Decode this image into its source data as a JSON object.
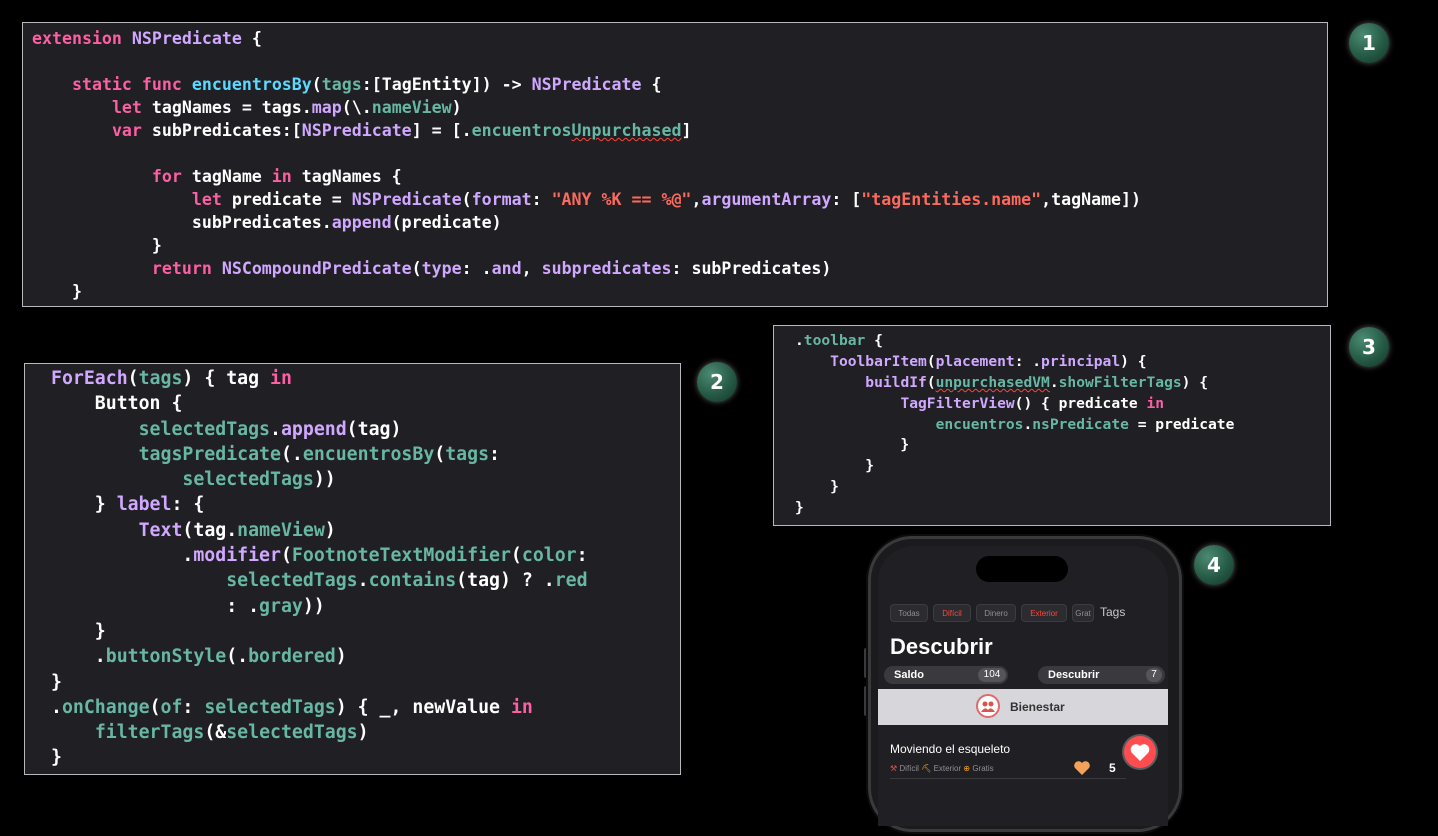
{
  "panel1": {
    "lines": [
      [
        [
          "kw",
          "extension"
        ],
        [
          "p",
          " "
        ],
        [
          "typ",
          "NSPredicate"
        ],
        [
          "p",
          " {"
        ]
      ],
      [],
      [
        [
          "p",
          "    "
        ],
        [
          "kw",
          "static"
        ],
        [
          "p",
          " "
        ],
        [
          "kw",
          "func"
        ],
        [
          "p",
          " "
        ],
        [
          "ident",
          "encuentrosBy"
        ],
        [
          "p",
          "("
        ],
        [
          "fn",
          "tags"
        ],
        [
          "p",
          ":[TagEntity]) -> "
        ],
        [
          "typ",
          "NSPredicate"
        ],
        [
          "p",
          " {"
        ]
      ],
      [
        [
          "p",
          "        "
        ],
        [
          "kw",
          "let"
        ],
        [
          "p",
          " tagNames = tags."
        ],
        [
          "typ",
          "map"
        ],
        [
          "p",
          "(\\."
        ],
        [
          "fn",
          "nameView"
        ],
        [
          "p",
          ")"
        ]
      ],
      [
        [
          "p",
          "        "
        ],
        [
          "kw",
          "var"
        ],
        [
          "p",
          " subPredicates:["
        ],
        [
          "typ",
          "NSPredicate"
        ],
        [
          "p",
          "] = [."
        ],
        [
          "fn",
          "encuentros"
        ],
        [
          "fsq",
          "Unpurchased"
        ],
        [
          "p",
          "]"
        ]
      ],
      [],
      [
        [
          "p",
          "            "
        ],
        [
          "kw",
          "for"
        ],
        [
          "p",
          " tagName "
        ],
        [
          "kw",
          "in"
        ],
        [
          "p",
          " tagNames {"
        ]
      ],
      [
        [
          "p",
          "                "
        ],
        [
          "kw",
          "let"
        ],
        [
          "p",
          " predicate = "
        ],
        [
          "typ",
          "NSPredicate"
        ],
        [
          "p",
          "("
        ],
        [
          "typ",
          "format"
        ],
        [
          "p",
          ": "
        ],
        [
          "str",
          "\"ANY %K == %@\""
        ],
        [
          "p",
          ","
        ],
        [
          "typ",
          "argumentArray"
        ],
        [
          "p",
          ": ["
        ],
        [
          "str",
          "\"tagEntities.name\""
        ],
        [
          "p",
          ",tagName])"
        ]
      ],
      [
        [
          "p",
          "                subPredicates."
        ],
        [
          "typ",
          "append"
        ],
        [
          "p",
          "(predicate)"
        ]
      ],
      [
        [
          "p",
          "            }"
        ]
      ],
      [
        [
          "p",
          "            "
        ],
        [
          "kw",
          "return"
        ],
        [
          "p",
          " "
        ],
        [
          "typ",
          "NSCompoundPredicate"
        ],
        [
          "p",
          "("
        ],
        [
          "typ",
          "type"
        ],
        [
          "p",
          ": ."
        ],
        [
          "typ",
          "and"
        ],
        [
          "p",
          ", "
        ],
        [
          "typ",
          "subpredicates"
        ],
        [
          "p",
          ": subPredicates)"
        ]
      ],
      [
        [
          "p",
          "    }"
        ]
      ]
    ]
  },
  "panel2": {
    "lines": [
      [
        [
          "typ",
          "ForEach"
        ],
        [
          "p",
          "("
        ],
        [
          "fn",
          "tags"
        ],
        [
          "p",
          ") { tag "
        ],
        [
          "kw",
          "in"
        ]
      ],
      [
        [
          "p",
          "    Button {"
        ]
      ],
      [
        [
          "p",
          "        "
        ],
        [
          "fn",
          "selectedTags"
        ],
        [
          "p",
          "."
        ],
        [
          "typ",
          "append"
        ],
        [
          "p",
          "(tag)"
        ]
      ],
      [
        [
          "p",
          "        "
        ],
        [
          "fn",
          "tagsPredicate"
        ],
        [
          "p",
          "(."
        ],
        [
          "fn",
          "encuentrosBy"
        ],
        [
          "p",
          "("
        ],
        [
          "fn",
          "tags"
        ],
        [
          "p",
          ":"
        ]
      ],
      [
        [
          "p",
          "            "
        ],
        [
          "fn",
          "selectedTags"
        ],
        [
          "p",
          "))"
        ]
      ],
      [
        [
          "p",
          "    } "
        ],
        [
          "typ",
          "label"
        ],
        [
          "p",
          ": {"
        ]
      ],
      [
        [
          "p",
          "        "
        ],
        [
          "typ",
          "Text"
        ],
        [
          "p",
          "(tag."
        ],
        [
          "fn",
          "nameView"
        ],
        [
          "p",
          ")"
        ]
      ],
      [
        [
          "p",
          "            ."
        ],
        [
          "typ",
          "modifier"
        ],
        [
          "p",
          "("
        ],
        [
          "fn",
          "FootnoteTextModifier"
        ],
        [
          "p",
          "("
        ],
        [
          "fn",
          "color"
        ],
        [
          "p",
          ":"
        ]
      ],
      [
        [
          "p",
          "                "
        ],
        [
          "fn",
          "selectedTags"
        ],
        [
          "p",
          "."
        ],
        [
          "fn",
          "contains"
        ],
        [
          "p",
          "(tag) ? ."
        ],
        [
          "fn",
          "red"
        ]
      ],
      [
        [
          "p",
          "                : ."
        ],
        [
          "fn",
          "gray"
        ],
        [
          "p",
          "))"
        ]
      ],
      [
        [
          "p",
          "    }"
        ]
      ],
      [
        [
          "p",
          "    ."
        ],
        [
          "fn",
          "buttonStyle"
        ],
        [
          "p",
          "(."
        ],
        [
          "fn",
          "bordered"
        ],
        [
          "p",
          ")"
        ]
      ],
      [
        [
          "p",
          "}"
        ]
      ],
      [
        [
          "p",
          "."
        ],
        [
          "fn",
          "onChange"
        ],
        [
          "p",
          "("
        ],
        [
          "fn",
          "of"
        ],
        [
          "p",
          ": "
        ],
        [
          "fn",
          "selectedTags"
        ],
        [
          "p",
          ") { _, newValue "
        ],
        [
          "kw",
          "in"
        ]
      ],
      [
        [
          "p",
          "    "
        ],
        [
          "fn",
          "filterTags"
        ],
        [
          "p",
          "(&"
        ],
        [
          "fn",
          "selectedTags"
        ],
        [
          "p",
          ")"
        ]
      ],
      [
        [
          "p",
          "}"
        ]
      ]
    ]
  },
  "panel3": {
    "lines": [
      [
        [
          "p",
          "."
        ],
        [
          "fn",
          "toolbar"
        ],
        [
          "p",
          " {"
        ]
      ],
      [
        [
          "p",
          "    "
        ],
        [
          "typ",
          "ToolbarItem"
        ],
        [
          "p",
          "("
        ],
        [
          "typ",
          "placement"
        ],
        [
          "p",
          ": ."
        ],
        [
          "typ",
          "principal"
        ],
        [
          "p",
          ") {"
        ]
      ],
      [
        [
          "p",
          "        "
        ],
        [
          "typ",
          "buildIf"
        ],
        [
          "p",
          "("
        ],
        [
          "fsq",
          "unpurchasedVM"
        ],
        [
          "p",
          "."
        ],
        [
          "fn",
          "showFilterTags"
        ],
        [
          "p",
          ") {"
        ]
      ],
      [
        [
          "p",
          "            "
        ],
        [
          "typ",
          "TagFilterView"
        ],
        [
          "p",
          "() { predicate "
        ],
        [
          "kw",
          "in"
        ]
      ],
      [
        [
          "p",
          "                "
        ],
        [
          "fn",
          "encuentros"
        ],
        [
          "p",
          "."
        ],
        [
          "fn",
          "nsPredicate"
        ],
        [
          "p",
          " = predicate"
        ]
      ],
      [
        [
          "p",
          "            }"
        ]
      ],
      [
        [
          "p",
          "        }"
        ]
      ],
      [
        [
          "p",
          "    }"
        ]
      ],
      [
        [
          "p",
          "}"
        ]
      ]
    ]
  },
  "badges": [
    "1",
    "2",
    "3",
    "4"
  ],
  "phone": {
    "chips": [
      "Todas",
      "Difícil",
      "Dinero",
      "Exterior",
      "Grat"
    ],
    "tags_label": "Tags",
    "title": "Descubrir",
    "pill_left": {
      "label": "Saldo",
      "count": "104"
    },
    "pill_right": {
      "label": "Descubrir",
      "count": "7"
    },
    "banner_label": "Bienestar",
    "row_title": "Moviendo el esqueleto",
    "row_meta": [
      "Difícil",
      "Exterior",
      "Gratis"
    ],
    "row_count": "5",
    "colors": {
      "accent_red": "#ff453a",
      "heart_orange": "#f3a15a"
    }
  }
}
